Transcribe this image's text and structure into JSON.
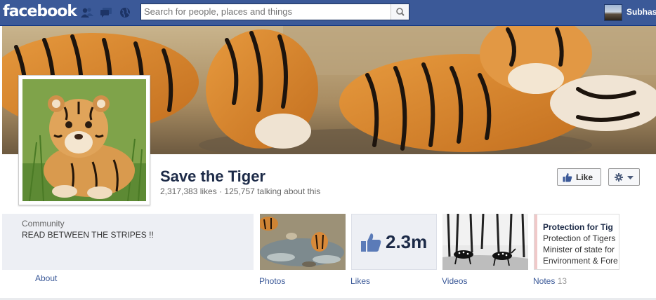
{
  "topbar": {
    "logo": "facebook",
    "search_placeholder": "Search for people, places and things",
    "user_name": "Subhas",
    "icons": [
      "friend-requests-icon",
      "messages-icon",
      "notifications-globe-icon",
      "search-icon"
    ]
  },
  "page": {
    "name": "Save the Tiger",
    "likes": "2,317,383 likes",
    "separator": "·",
    "talking": "125,757 talking about this",
    "like_button": "Like",
    "category": "Community",
    "description": "READ BETWEEN THE STRIPES !!"
  },
  "apps": {
    "about": "About",
    "photos": "Photos",
    "likes": "Likes",
    "likes_count": "2.3m",
    "videos": "Videos",
    "notes": "Notes",
    "notes_count": "13",
    "notes_preview": [
      "Protection for Tig",
      "Protection of Tigers",
      "Minister of state for",
      "Environment & Fore"
    ]
  },
  "colors": {
    "brand": "#3b5998",
    "link": "#3b5998",
    "title": "#1c2a47"
  }
}
